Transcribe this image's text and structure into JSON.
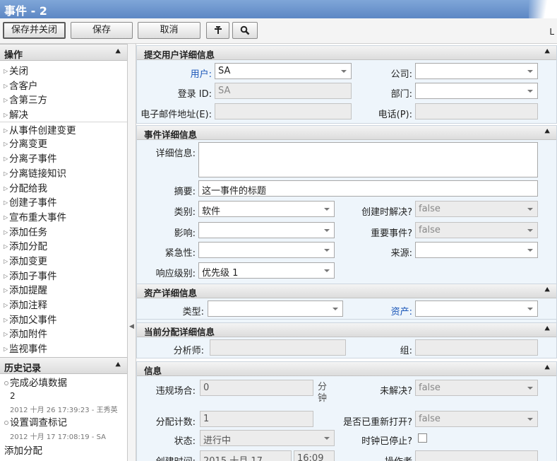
{
  "window": {
    "title": "事件 - 2"
  },
  "toolbar": {
    "save_close": "保存并关闭",
    "save": "保存",
    "cancel": "取消",
    "right_label": "L"
  },
  "actions": {
    "header": "操作",
    "items": [
      "关闭",
      "含客户",
      "含第三方",
      "解决",
      "从事件创建变更",
      "分离变更",
      "分离子事件",
      "分离链接知识",
      "分配给我",
      "创建子事件",
      "宣布重大事件",
      "添加任务",
      "添加分配",
      "添加变更",
      "添加子事件",
      "添加提醒",
      "添加注释",
      "添加父事件",
      "添加附件",
      "监视事件"
    ]
  },
  "history": {
    "header": "历史记录",
    "entries": [
      {
        "title": "完成必填数据",
        "value": "2",
        "meta": "2012 十月 26 17:39:23 - 王秀英"
      },
      {
        "title": "设置调查标记",
        "meta": "2012 十月 17 17:08:19 - SA"
      },
      {
        "title": "添加分配"
      }
    ]
  },
  "user_section": {
    "header": "提交用户详细信息",
    "user_label": "用户:",
    "user_value": "SA",
    "login_label": "登录 ID:",
    "login_value": "SA",
    "email_label": "电子邮件地址(E):",
    "company_label": "公司:",
    "dept_label": "部门:",
    "phone_label": "电话(P):"
  },
  "incident_section": {
    "header": "事件详细信息",
    "detail_label": "详细信息:",
    "summary_label": "摘要:",
    "summary_value": "这一事件的标题",
    "category_label": "类别:",
    "category_value": "软件",
    "resolve_label": "创建时解决?",
    "resolve_value": "false",
    "impact_label": "影响:",
    "major_label": "重要事件?",
    "major_value": "false",
    "urgency_label": "紧急性:",
    "source_label": "来源:",
    "response_label": "响应级别:",
    "response_value": "优先级  1"
  },
  "asset_section": {
    "header": "资产详细信息",
    "type_label": "类型:",
    "asset_label": "资产:"
  },
  "assign_section": {
    "header": "当前分配详细信息",
    "analyst_label": "分析师:",
    "group_label": "组:"
  },
  "info_section": {
    "header": "信息",
    "breach_label": "违规场合:",
    "breach_value": "0",
    "breach_unit": "分钟",
    "unresolved_label": "未解决?",
    "unresolved_value": "false",
    "assign_count_label": "分配计数:",
    "assign_count_value": "1",
    "reopened_label": "是否已重新打开?",
    "reopened_value": "false",
    "status_label": "状态:",
    "status_value": "进行中",
    "clock_label": "时钟已停止?",
    "created_label": "创建时间:",
    "created_value": "2015 十月 17",
    "created_time": "16:09",
    "operator_label": "操作者"
  }
}
